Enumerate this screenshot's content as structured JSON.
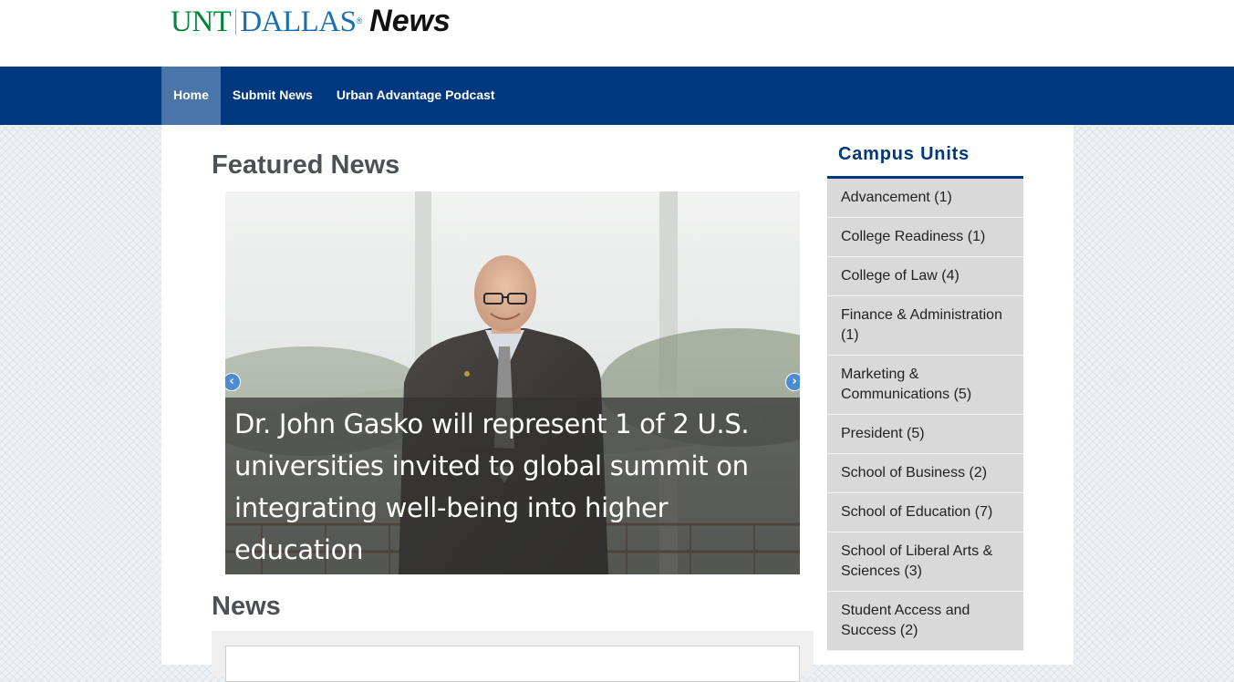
{
  "brand": {
    "unt": "UNT",
    "dallas": "DALLAS",
    "reg": "®",
    "news": "News"
  },
  "nav": {
    "items": [
      {
        "label": "Home",
        "active": true
      },
      {
        "label": "Submit News"
      },
      {
        "label": "Urban Advantage Podcast"
      }
    ]
  },
  "main": {
    "featured_heading": "Featured News",
    "carousel": {
      "caption": "Dr. John Gasko will represent 1 of 2 U.S. universities invited to global summit on integrating well-being into higher education",
      "prev_icon": "‹",
      "next_icon": "›"
    },
    "news_heading": "News"
  },
  "sidebar": {
    "title": "Campus Units",
    "items": [
      "Advancement (1)",
      "College Readiness (1)",
      "College of Law (4)",
      "Finance & Administration (1)",
      "Marketing & Communications (5)",
      "President (5)",
      "School of Business (2)",
      "School of Education (7)",
      "School of Liberal Arts & Sciences (3)",
      "Student Access and Success (2)"
    ]
  },
  "colors": {
    "nav_bg": "#00387f",
    "nav_active": "#4a75a8",
    "unt_green": "#00853e",
    "dallas_blue": "#1a6fb0"
  }
}
